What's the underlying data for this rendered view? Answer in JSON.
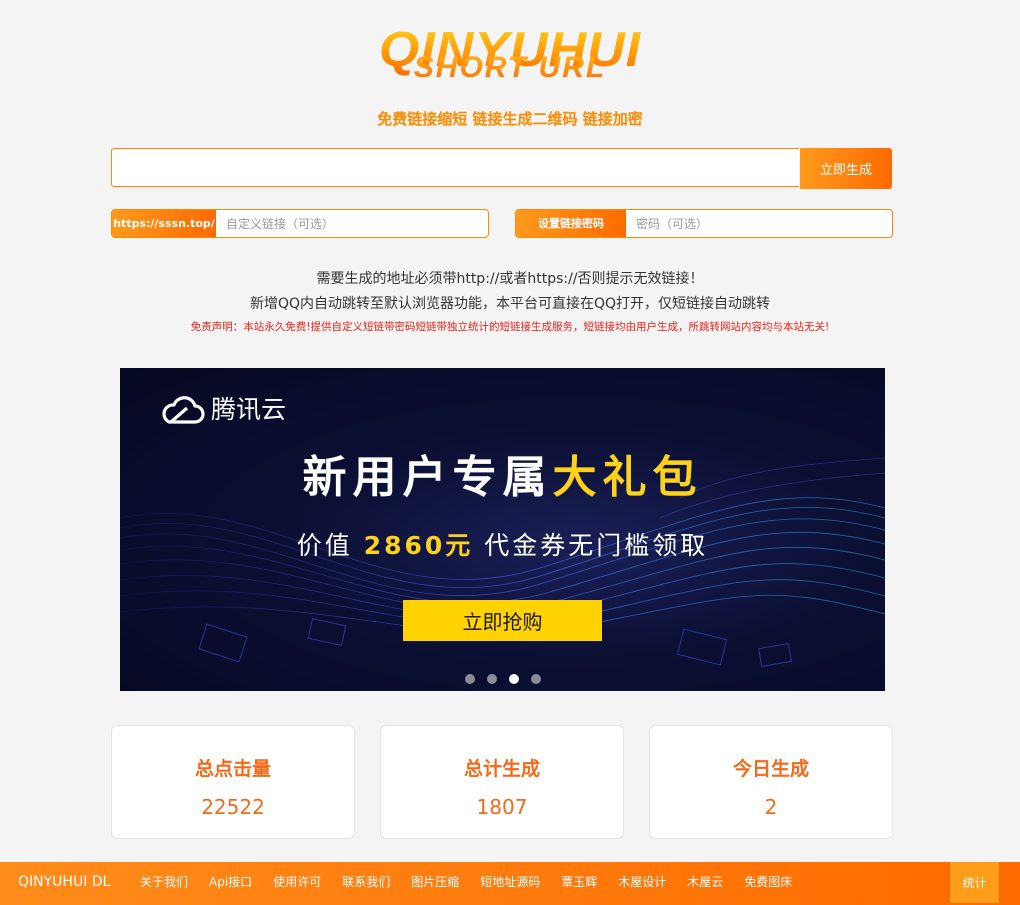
{
  "logo": {
    "main_text": "QINYUHUI",
    "sub_text": "SHORT URL",
    "slogan": "免费链接缩短  链接生成二维码   链接加密"
  },
  "form": {
    "url_value": "",
    "generate_label": "立即生成",
    "domain_label": "https://sssn.top/",
    "custom_placeholder": "自定义链接（可选）",
    "password_label": "设置链接密码",
    "password_placeholder": "密码（可选）"
  },
  "notices": {
    "line1": "需要生成的地址必须带http://或者https://否则提示无效链接！",
    "line2": "新增QQ内自动跳转至默认浏览器功能，本平台可直接在QQ打开，仅短链接自动跳转",
    "disclaimer": "免责声明：本站永久免费!提供自定义短链带密码短链带独立统计的短链接生成服务，短链接均由用户生成，所跳转网站内容均与本站无关!"
  },
  "banner": {
    "brand": "腾讯云",
    "title_main": "新用户专属",
    "title_highlight": "大礼包",
    "sub_prefix": "价值 ",
    "sub_highlight": "2860元",
    "sub_suffix": " 代金券无门槛领取",
    "button_label": "立即抢购",
    "slide_count": 4,
    "active_slide": 3
  },
  "stats": [
    {
      "label": "总点击量",
      "value": "22522"
    },
    {
      "label": "总计生成",
      "value": "1807"
    },
    {
      "label": "今日生成",
      "value": "2"
    }
  ],
  "footer": {
    "brand": "QINYUHUI DL",
    "links": [
      "关于我们",
      "Api接口",
      "使用许可",
      "联系我们",
      "图片压缩",
      "短地址源码",
      "覃玉辉",
      "木屋设计",
      "木屋云",
      "免费图床"
    ],
    "stats_label": "统计"
  },
  "colors": {
    "accent": "#ff6a00",
    "accent_light": "#ff9a1c",
    "stat_text": "#f26a1a",
    "disclaimer": "#e8231a",
    "banner_bg": "#0b0f33",
    "banner_highlight": "#ffd21a"
  }
}
